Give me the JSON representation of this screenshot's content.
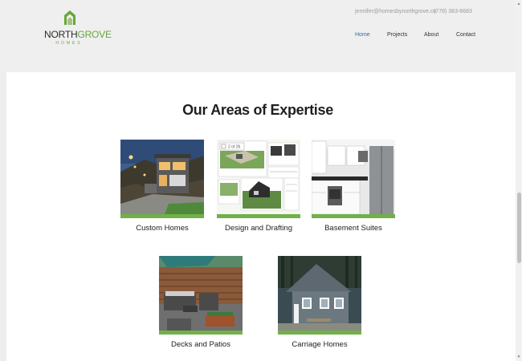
{
  "brand": {
    "name_part1": "NORTH",
    "name_part2": "GROVE",
    "tagline": "HOMES",
    "logo_color": "#6aa63a"
  },
  "contact": {
    "email": "jennifer@homesbynorthgrove.co",
    "phone": "(778) 383-8683"
  },
  "nav": {
    "items": [
      {
        "label": "Home",
        "active": true
      },
      {
        "label": "Projects",
        "active": false
      },
      {
        "label": "About",
        "active": false
      },
      {
        "label": "Contact",
        "active": false
      }
    ],
    "active_color": "#2a6fa8"
  },
  "section": {
    "title": "Our Areas of Expertise"
  },
  "cards": [
    {
      "label": "Custom Homes",
      "image": "modern-hillside-house-photo"
    },
    {
      "label": "Design and Drafting",
      "image": "site-plan-drawings-collage",
      "overlay_text": "2 of 26"
    },
    {
      "label": "Basement Suites",
      "image": "kitchen-interior-photo"
    },
    {
      "label": "Decks and Patios",
      "image": "deck-patio-photo"
    },
    {
      "label": "Carriage Homes",
      "image": "grey-cottage-photo"
    }
  ],
  "accent_color": "#72b04a"
}
